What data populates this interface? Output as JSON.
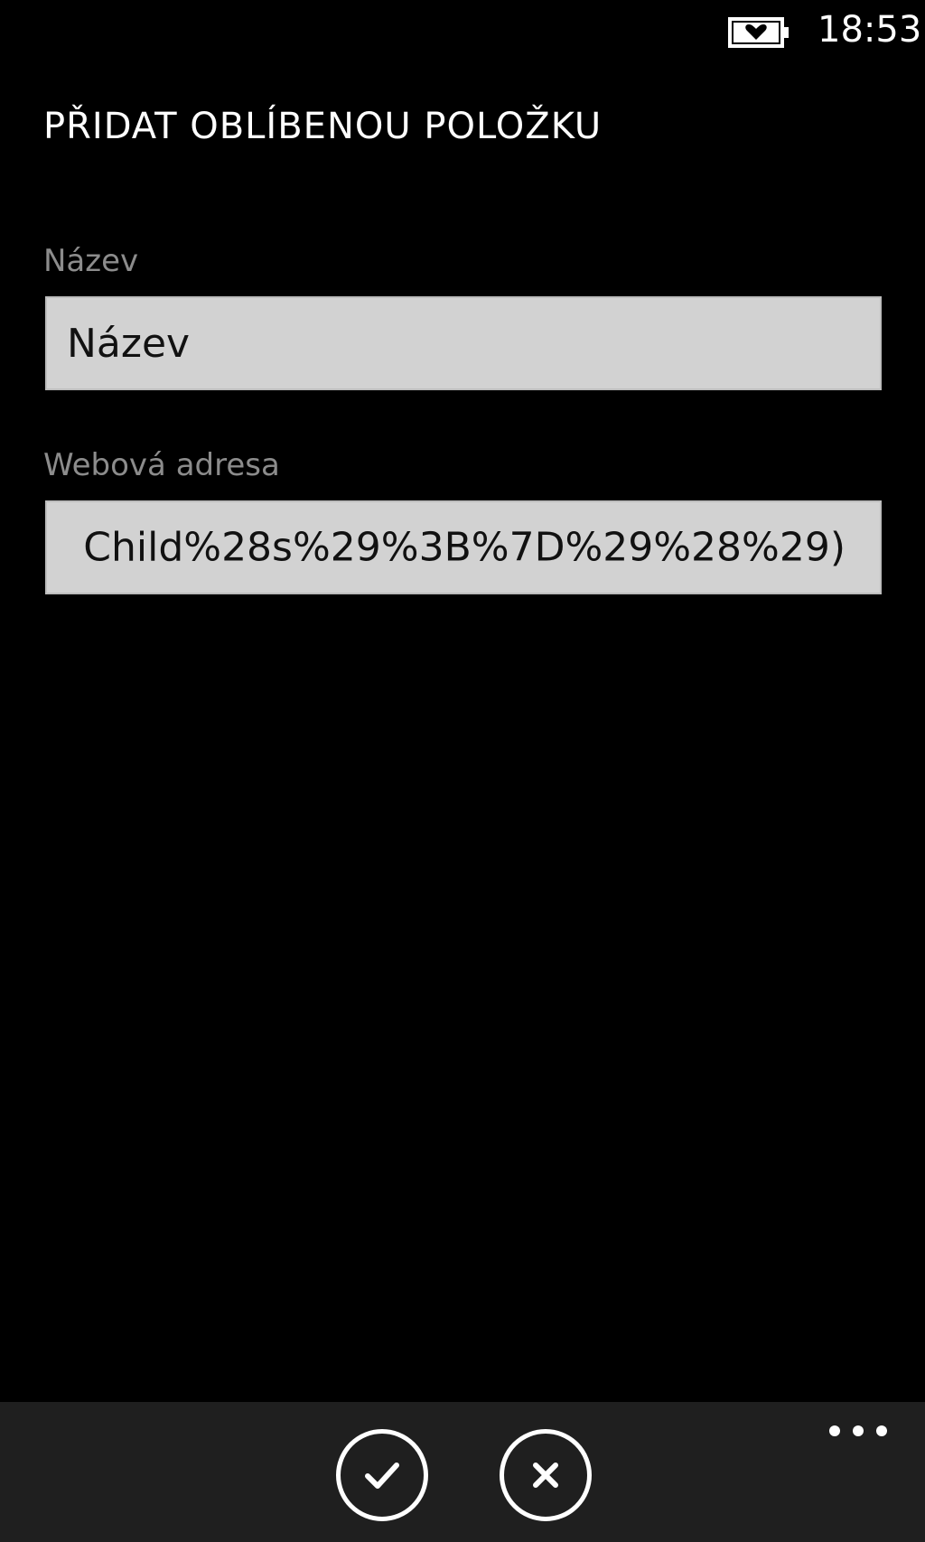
{
  "status_bar": {
    "time": "18:53",
    "battery_icon": "battery-heart-icon"
  },
  "page": {
    "title": "PŘIDAT OBLÍBENOU POLOŽKU"
  },
  "form": {
    "name": {
      "label": "Název",
      "value": "Název"
    },
    "url": {
      "label": "Webová adresa",
      "visible_value": "Child%28s%29%3B%7D%29%28%29)"
    }
  },
  "app_bar": {
    "buttons": [
      {
        "icon": "check-icon"
      },
      {
        "icon": "close-icon"
      }
    ],
    "more_icon": "more-dots-icon"
  },
  "colors": {
    "background": "#000000",
    "app_bar": "#1f1f1f",
    "textbox": "#d2d2d2",
    "label": "#8c8c8c"
  }
}
